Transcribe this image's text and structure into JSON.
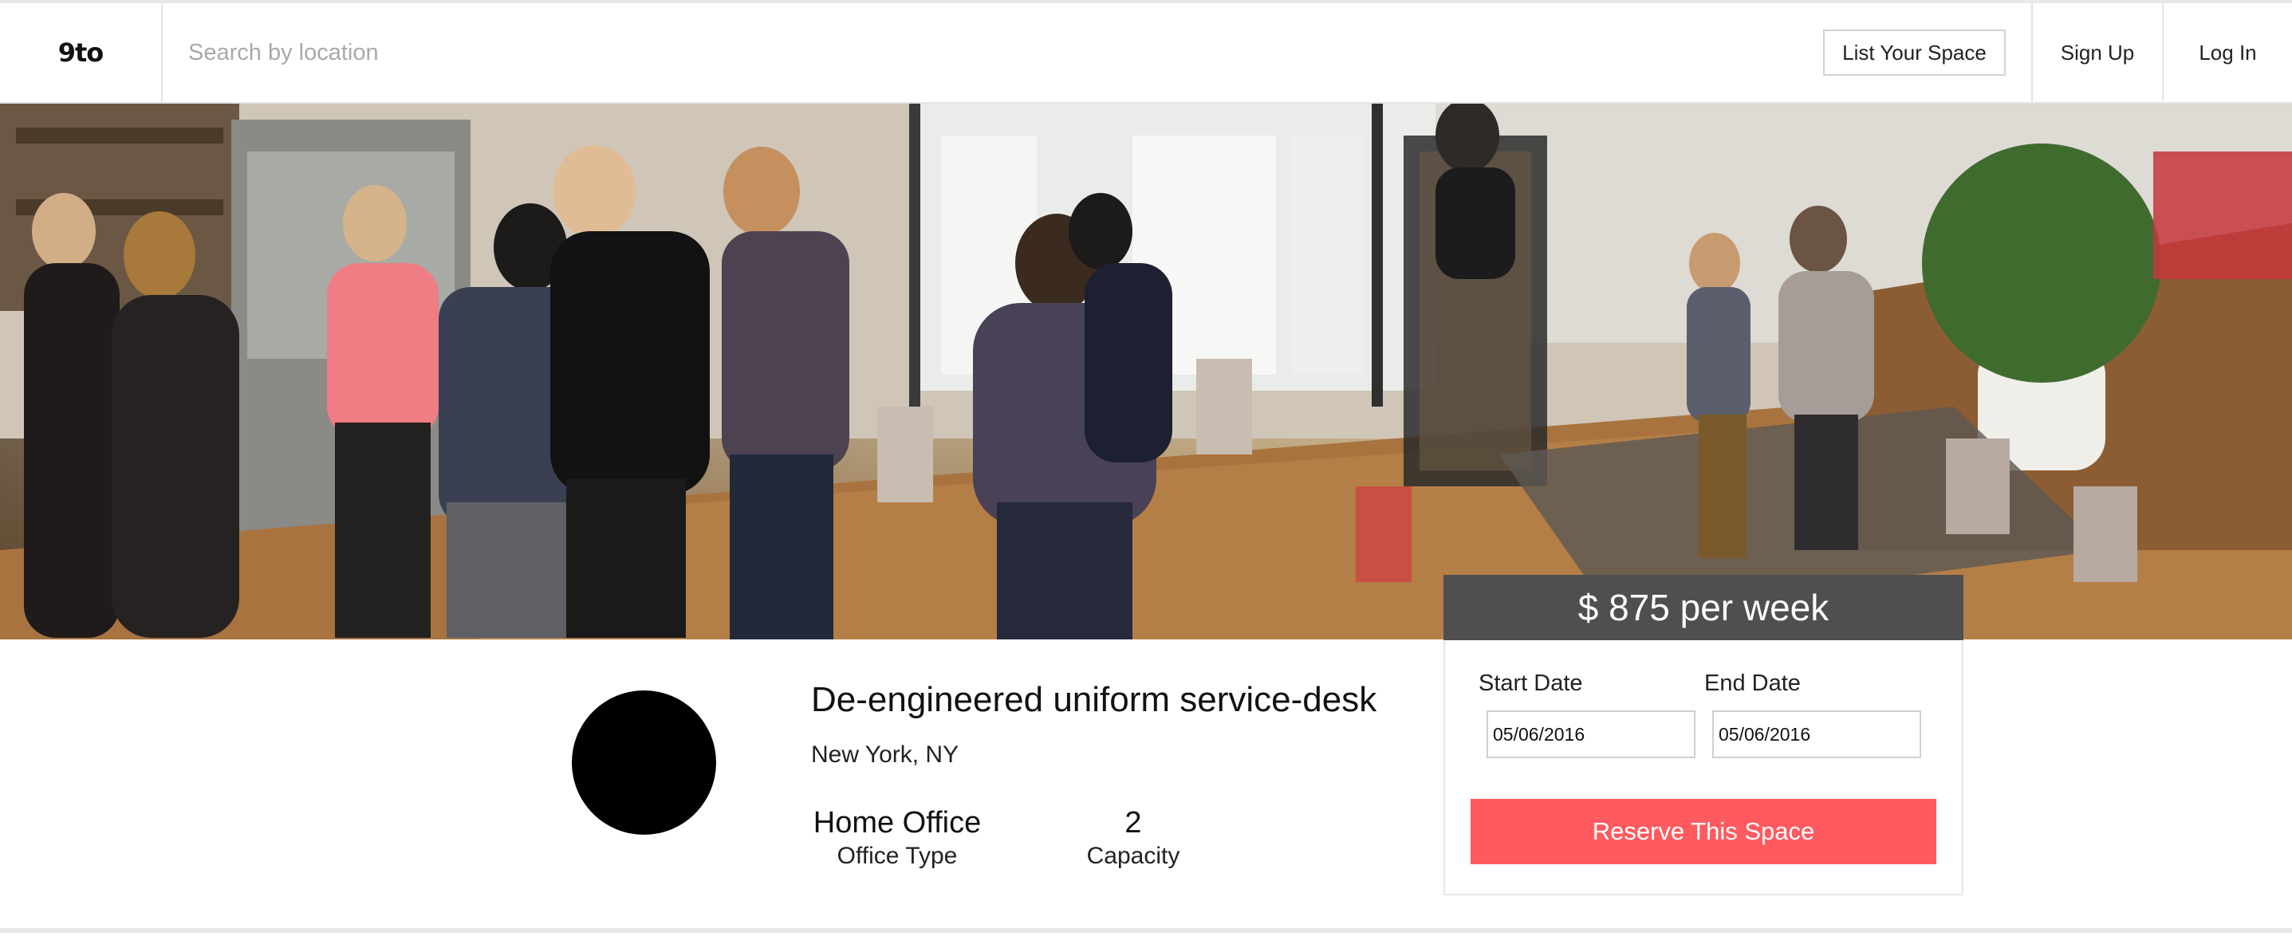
{
  "header": {
    "logo": "9to",
    "search_placeholder": "Search by location",
    "list_space_label": "List Your Space",
    "sign_up_label": "Sign Up",
    "log_in_label": "Log In"
  },
  "booking": {
    "price_text": "$ 875 per week",
    "start_date_label": "Start Date",
    "end_date_label": "End Date",
    "start_date_value": "05/06/2016",
    "end_date_value": "05/06/2016",
    "reserve_label": "Reserve This Space",
    "accent_color": "#ff5a5f",
    "price_bar_color": "#4f4f4f"
  },
  "listing": {
    "title": "De-engineered uniform service-desk",
    "location": "New York, NY",
    "office_type_value": "Home Office",
    "office_type_label": "Office Type",
    "capacity_value": "2",
    "capacity_label": "Capacity"
  }
}
